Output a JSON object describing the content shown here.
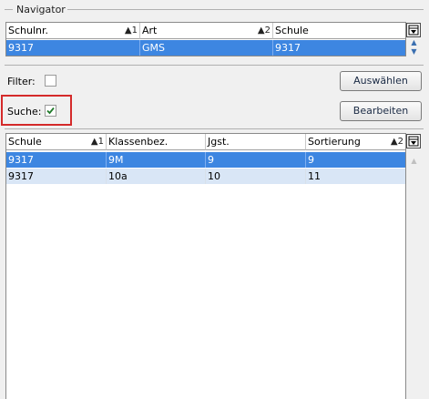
{
  "navigator": {
    "title": "Navigator",
    "columns": [
      {
        "label": "Schulnr.",
        "sort": "1"
      },
      {
        "label": "Art",
        "sort": "2"
      },
      {
        "label": "Schule",
        "sort": ""
      }
    ],
    "rows": [
      {
        "schulnr": "9317",
        "art": "GMS",
        "schule": "9317"
      }
    ]
  },
  "filter": {
    "label": "Filter:",
    "checked": false
  },
  "suche": {
    "label": "Suche:",
    "checked": true
  },
  "buttons": {
    "auswaehlen": "Auswählen",
    "bearbeiten": "Bearbeiten"
  },
  "classes": {
    "columns": [
      {
        "label": "Schule",
        "sort": "1"
      },
      {
        "label": "Klassenbez.",
        "sort": ""
      },
      {
        "label": "Jgst.",
        "sort": ""
      },
      {
        "label": "Sortierung",
        "sort": "2"
      }
    ],
    "rows": [
      {
        "schule": "9317",
        "klasse": "9M",
        "jgst": "9",
        "sort": "9"
      },
      {
        "schule": "9317",
        "klasse": "10a",
        "jgst": "10",
        "sort": "11"
      }
    ]
  },
  "colors": {
    "selection": "#3d86e1",
    "alt_row": "#d9e6f6",
    "highlight_border": "#d42a2a"
  },
  "icons": {
    "sort_arrow": "sort-ascending-icon",
    "column_chooser": "column-chooser-icon"
  }
}
